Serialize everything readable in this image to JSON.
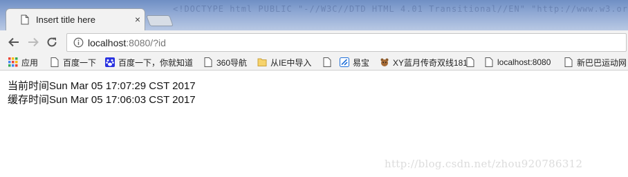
{
  "browser": {
    "tab": {
      "title": "Insert title here",
      "close": "×"
    },
    "address": {
      "host": "localhost",
      "rest": ":8080/?id"
    }
  },
  "bookmarks": [
    {
      "label": "应用",
      "icon": "apps-grid-icon"
    },
    {
      "label": "百度一下",
      "icon": "page-icon"
    },
    {
      "label": "百度一下，你就知道",
      "icon": "baidu-paw-icon"
    },
    {
      "label": "360导航",
      "icon": "page-icon"
    },
    {
      "label": "从IE中导入",
      "icon": "folder-icon"
    },
    {
      "label": "",
      "icon": "page-icon"
    },
    {
      "label": "易宝",
      "icon": "yibao-icon"
    },
    {
      "label": "XY蓝月传奇双线181",
      "faded": "3",
      "icon": "game-icon"
    },
    {
      "label": "",
      "icon": "page-icon"
    },
    {
      "label": "localhost:8080",
      "icon": "page-icon"
    },
    {
      "label": "",
      "icon": "page-icon"
    },
    {
      "label": "新巴巴运动网",
      "icon": "page-icon"
    }
  ],
  "page": {
    "lines": [
      "当前时间Sun Mar 05 17:07:29 CST 2017",
      "缓存时间Sun Mar 05 17:06:03 CST 2017"
    ],
    "watermark": "http://blog.csdn.net/zhou920786312"
  },
  "colors": {
    "titlebar": "#7f9bcc",
    "toolbar": "#f2f2f2",
    "tab": "#f2f2f2",
    "url_host": "#222222",
    "url_rest": "#777777"
  }
}
